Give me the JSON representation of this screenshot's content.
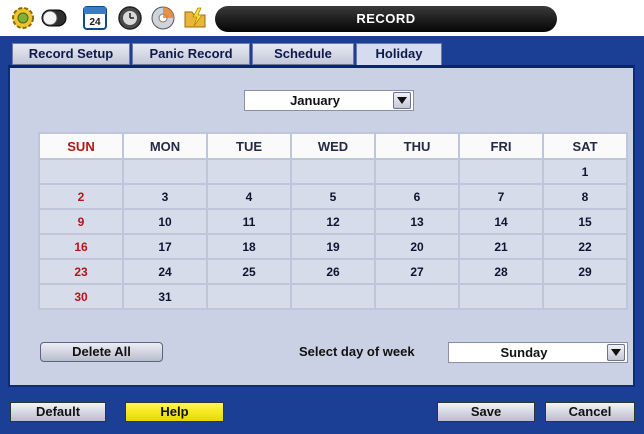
{
  "window": {
    "title": "RECORD"
  },
  "toolbar_icons": [
    "settings-icon",
    "toggle-icon",
    "calendar-icon",
    "clock-icon",
    "disc-icon",
    "folder-icon"
  ],
  "toolbar": {
    "calendar_day": "24"
  },
  "tabs": [
    {
      "label": "Record Setup",
      "active": false
    },
    {
      "label": "Panic Record",
      "active": false
    },
    {
      "label": "Schedule",
      "active": false
    },
    {
      "label": "Holiday",
      "active": true
    }
  ],
  "month_select": {
    "value": "January"
  },
  "calendar": {
    "headers": [
      "SUN",
      "MON",
      "TUE",
      "WED",
      "THU",
      "FRI",
      "SAT"
    ],
    "weeks": [
      [
        "",
        "",
        "",
        "",
        "",
        "",
        "1"
      ],
      [
        "2",
        "3",
        "4",
        "5",
        "6",
        "7",
        "8"
      ],
      [
        "9",
        "10",
        "11",
        "12",
        "13",
        "14",
        "15"
      ],
      [
        "16",
        "17",
        "18",
        "19",
        "20",
        "21",
        "22"
      ],
      [
        "23",
        "24",
        "25",
        "26",
        "27",
        "28",
        "29"
      ],
      [
        "30",
        "31",
        "",
        "",
        "",
        "",
        ""
      ]
    ],
    "sunday_color": "#b31616"
  },
  "delete_all": {
    "label": "Delete All"
  },
  "day_of_week": {
    "label": "Select day of week",
    "value": "Sunday"
  },
  "footer": {
    "default_label": "Default",
    "help_label": "Help",
    "save_label": "Save",
    "cancel_label": "Cancel"
  },
  "colors": {
    "background": "#1c3f96",
    "panel": "#cbd1e5",
    "help_button": "#fff84a"
  }
}
